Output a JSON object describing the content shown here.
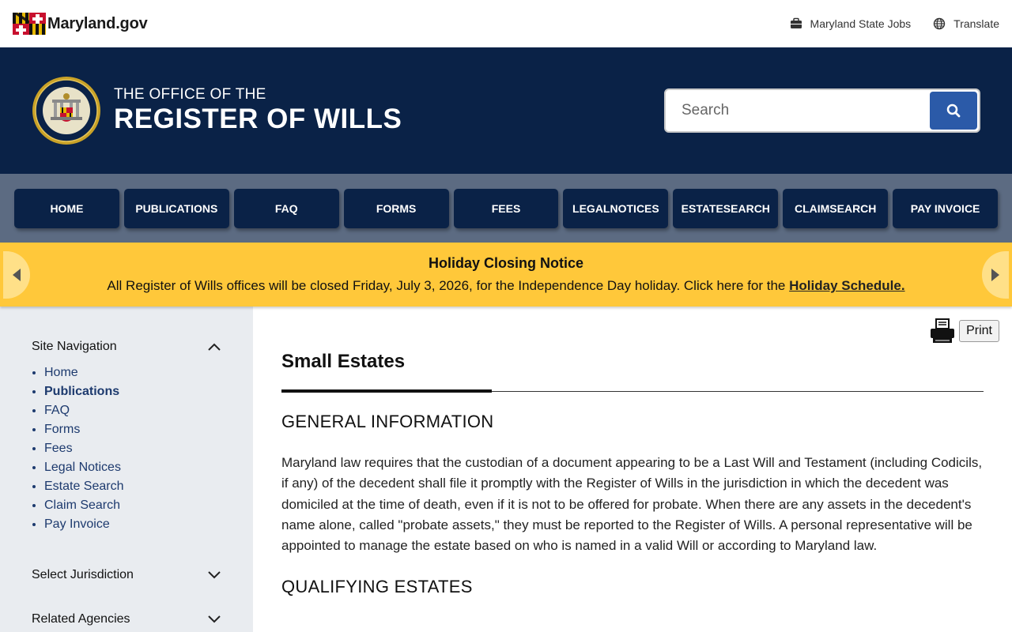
{
  "utility": {
    "logo_text": "Maryland.gov",
    "jobs_label": "Maryland State Jobs",
    "translate_label": "Translate"
  },
  "header": {
    "title_small": "THE OFFICE OF THE",
    "title_large": "REGISTER OF WILLS",
    "search_placeholder": "Search"
  },
  "nav": {
    "home": "HOME",
    "publications": "PUBLICATIONS",
    "faq": "FAQ",
    "forms": "FORMS",
    "fees": "FEES",
    "legal_notices_1": "LEGAL",
    "legal_notices_2": "NOTICES",
    "estate_search_1": "ESTATE",
    "estate_search_2": "SEARCH",
    "claim_search_1": "CLAIM",
    "claim_search_2": "SEARCH",
    "pay_invoice": "PAY INVOICE"
  },
  "alert": {
    "title": "Holiday Closing Notice",
    "body": "All Register of Wills offices will be closed Friday, July 3, 2026, for the Independence Day holiday. Click here for the ",
    "link": "Holiday Schedule."
  },
  "sidebar": {
    "heading": "Site Navigation",
    "items": [
      "Home",
      "Publications",
      "FAQ",
      "Forms",
      "Fees",
      "Legal Notices",
      "Estate Search",
      "Claim Search",
      "Pay Invoice"
    ],
    "select_jurisdiction": "Select Jurisdiction",
    "related_agencies": "Related Agencies"
  },
  "main": {
    "print_label": "Print",
    "page_title": "Small Estates",
    "section1_heading": "GENERAL INFORMATION",
    "section1_text": "Maryland law requires that the custodian of a document appearing to be a Last Will and Testament (including Codicils, if any) of the decedent shall file it promptly with the Register of Wills in the jurisdiction in which the decedent was domiciled at the time of death, even if it is not to be offered for probate. When there are any assets in the decedent's name alone, called \"probate assets,\" they must be reported to the Register of Wills. A personal representative will be appointed to manage the estate based on who is named in a valid Will or according to Maryland law.",
    "section2_heading": "QUALIFYING ESTATES"
  },
  "colors": {
    "header_bg": "#0a2247",
    "nav_bg": "#5c6b82",
    "alert_bg": "#ffc83a",
    "search_btn": "#2b5aa8",
    "sidebar_bg": "#e9ecf0"
  }
}
